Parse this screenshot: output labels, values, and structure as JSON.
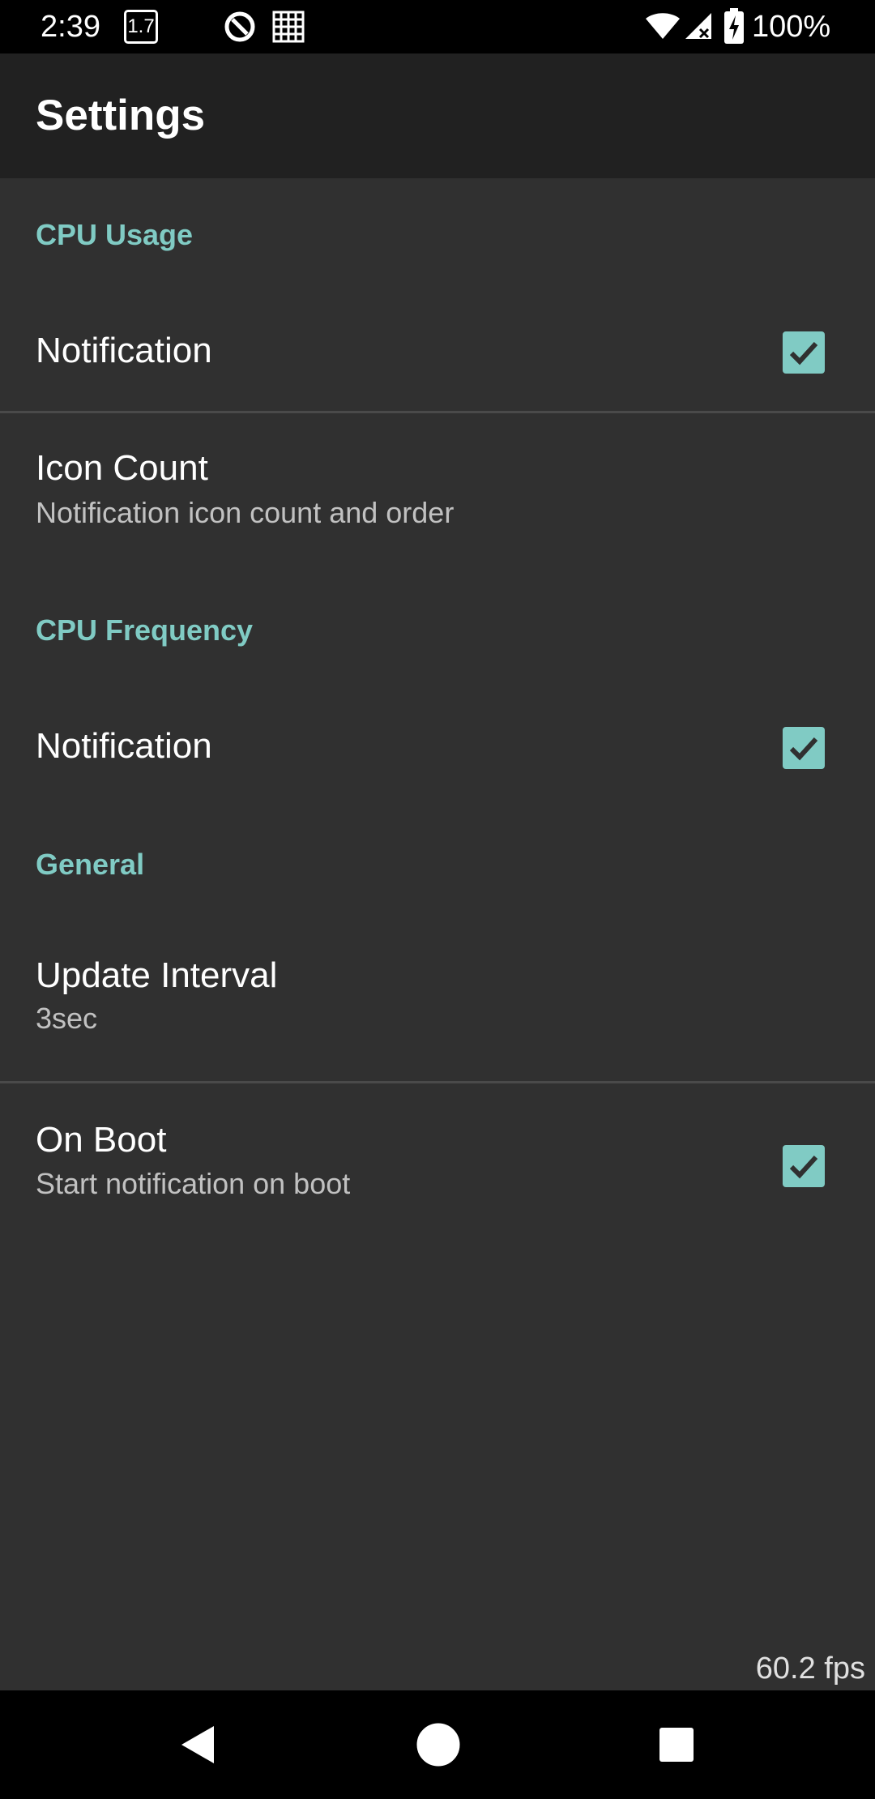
{
  "status_bar": {
    "time": "2:39",
    "cpu_indicator": "1.7",
    "battery_percent": "100%",
    "icons": [
      "cpu-indicator-icon",
      "at-sign-icon",
      "grid-icon",
      "wifi-icon",
      "cellular-no-signal-icon",
      "battery-charging-icon"
    ]
  },
  "app_bar": {
    "title": "Settings"
  },
  "categories": {
    "cpu_usage": "CPU Usage",
    "cpu_frequency": "CPU Frequency",
    "general": "General"
  },
  "prefs": {
    "cpu_usage_notification": {
      "title": "Notification",
      "checked": true
    },
    "icon_count": {
      "title": "Icon Count",
      "summary": "Notification icon count and order"
    },
    "cpu_frequency_notification": {
      "title": "Notification",
      "checked": true
    },
    "update_interval": {
      "title": "Update Interval",
      "summary": "3sec"
    },
    "on_boot": {
      "title": "On Boot",
      "summary": "Start notification on boot",
      "checked": true
    }
  },
  "fps_overlay": "60.2 fps",
  "nav_bar": {
    "icons": [
      "back-icon",
      "home-icon",
      "recents-icon"
    ]
  },
  "colors": {
    "accent": "#80cbc4",
    "background": "#303030",
    "app_bar": "#212121"
  }
}
